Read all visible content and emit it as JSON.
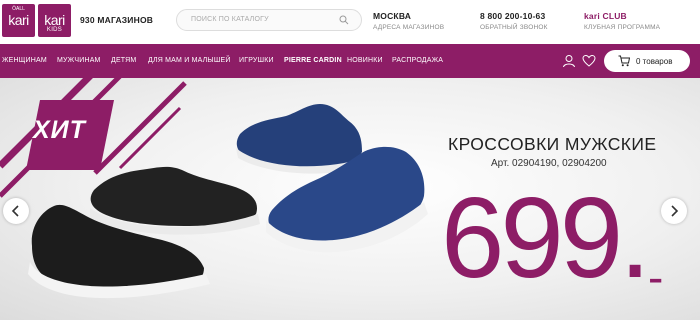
{
  "header": {
    "logo_kari": {
      "top": "ÖALL",
      "main": "kari",
      "sub": ""
    },
    "logo_kids": {
      "main": "kari",
      "sub": "KIDS"
    },
    "stores": "930 МАГАЗИНОВ",
    "search": {
      "placeholder": "ПОИСК ПО КАТАЛОГУ"
    },
    "city": {
      "title": "МОСКВА",
      "subtitle": "АДРЕСА МАГАЗИНОВ"
    },
    "phone": {
      "title": "8 800 200-10-63",
      "subtitle": "ОБРАТНЫЙ ЗВОНОК"
    },
    "club": {
      "title": "kari CLUB",
      "subtitle": "КЛУБНАЯ ПРОГРАММА"
    }
  },
  "nav": {
    "items": [
      {
        "label": "ЖЕНЩИНАМ"
      },
      {
        "label": "МУЖЧИНАМ"
      },
      {
        "label": "ДЕТЯМ"
      },
      {
        "label": "ДЛЯ МАМ И МАЛЫШЕЙ"
      },
      {
        "label": "ИГРУШКИ"
      },
      {
        "label": "PIERRE CARDIN"
      },
      {
        "label": "НОВИНКИ"
      },
      {
        "label": "РАСПРОДАЖА"
      }
    ],
    "cart_label": "0 товаров"
  },
  "banner": {
    "badge": "ХИТ",
    "title": "КРОССОВКИ МУЖСКИЕ",
    "article": "Арт. 02904190, 02904200",
    "price": "699.",
    "price_suffix": "-"
  },
  "colors": {
    "brand": "#8d1d66",
    "black_shoe": "#1c1c1c",
    "blue_shoe": "#25407a"
  },
  "icons": [
    "search-icon",
    "user-icon",
    "heart-icon",
    "cart-icon",
    "chevron-left-icon",
    "chevron-right-icon"
  ]
}
